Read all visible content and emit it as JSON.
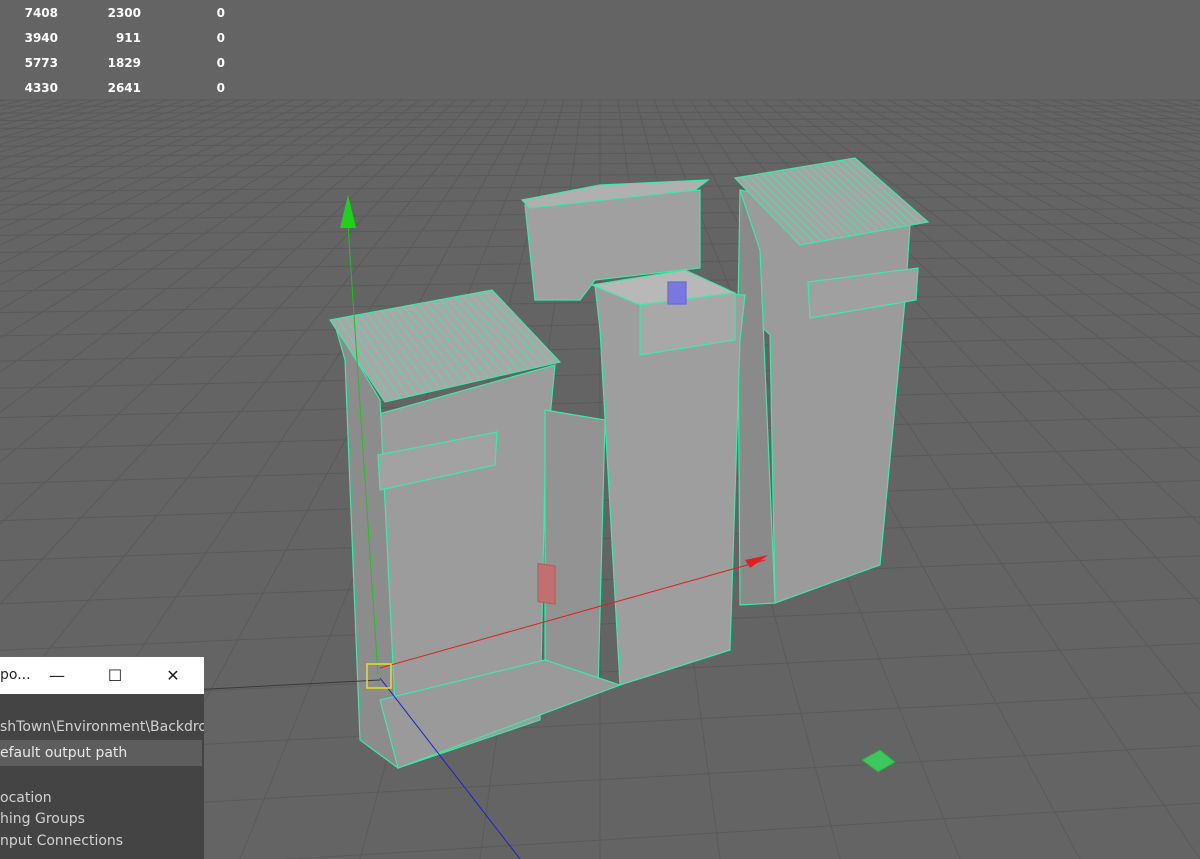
{
  "stats": {
    "rows": [
      [
        "7408",
        "2300",
        "0"
      ],
      [
        "3940",
        "911",
        "0"
      ],
      [
        "5773",
        "1829",
        "0"
      ],
      [
        "4330",
        "2641",
        "0"
      ]
    ]
  },
  "panel": {
    "title": "po...",
    "minimize_glyph": "—",
    "maximize_glyph": "☐",
    "close_glyph": "✕",
    "path_text": "shTown\\Environment\\Backdrop\\",
    "default_output_label": "efault output path",
    "location_label": "ocation",
    "smoothing_label": "hing Groups",
    "input_connections_label": "nput Connections"
  },
  "colors": {
    "viewport_bg": "#646464",
    "grid_line": "#5a5a5a",
    "wireframe": "#3ee8a8",
    "geometry_face": "#9a9a9a",
    "axis_x": "#e02020",
    "axis_y": "#20c020",
    "axis_z": "#2020c8",
    "pivot": "#e0e030"
  },
  "icons": {
    "move_y_handle": "green-cone-arrow",
    "move_x_handle": "red-cone-arrow",
    "pivot": "yellow-square-pivot"
  }
}
